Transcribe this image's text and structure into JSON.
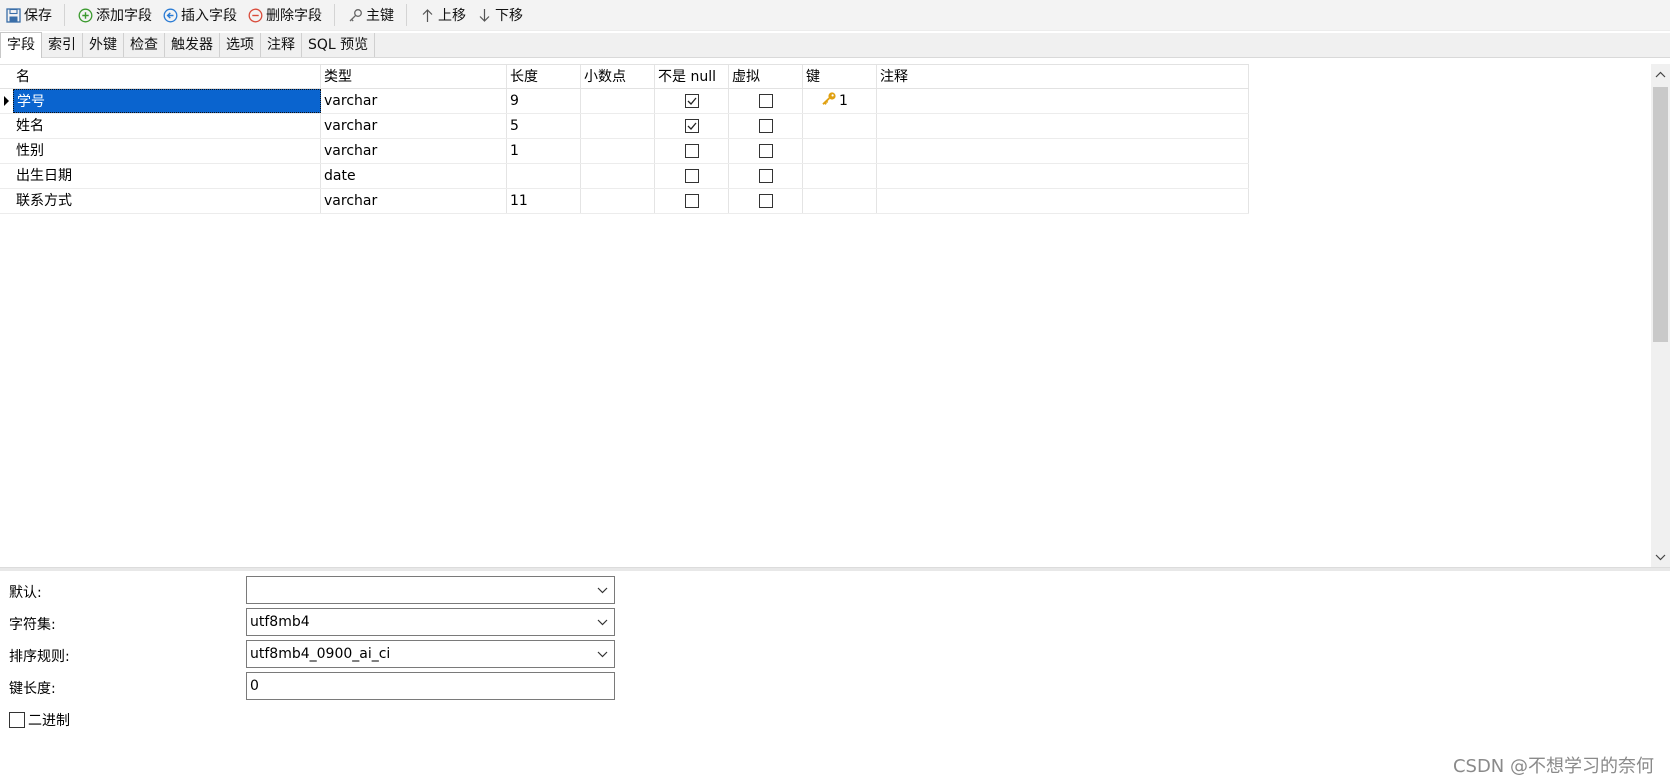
{
  "toolbar": {
    "save": "保存",
    "add_field": "添加字段",
    "insert_field": "插入字段",
    "delete_field": "删除字段",
    "primary_key": "主键",
    "move_up": "上移",
    "move_down": "下移"
  },
  "tabs": [
    {
      "label": "字段",
      "active": true
    },
    {
      "label": "索引"
    },
    {
      "label": "外键"
    },
    {
      "label": "检查"
    },
    {
      "label": "触发器"
    },
    {
      "label": "选项"
    },
    {
      "label": "注释"
    },
    {
      "label": "SQL 预览"
    }
  ],
  "grid": {
    "headers": {
      "name": "名",
      "type": "类型",
      "length": "长度",
      "decimals": "小数点",
      "not_null": "不是 null",
      "virtual": "虚拟",
      "key": "键",
      "comment": "注释"
    },
    "rows": [
      {
        "name": "学号",
        "type": "varchar",
        "length": "9",
        "decimals": "",
        "not_null": true,
        "virtual": false,
        "key": "1",
        "comment": ""
      },
      {
        "name": "姓名",
        "type": "varchar",
        "length": "5",
        "decimals": "",
        "not_null": true,
        "virtual": false,
        "key": "",
        "comment": ""
      },
      {
        "name": "性别",
        "type": "varchar",
        "length": "1",
        "decimals": "",
        "not_null": false,
        "virtual": false,
        "key": "",
        "comment": ""
      },
      {
        "name": "出生日期",
        "type": "date",
        "length": "",
        "decimals": "",
        "not_null": false,
        "virtual": false,
        "key": "",
        "comment": ""
      },
      {
        "name": "联系方式",
        "type": "varchar",
        "length": "11",
        "decimals": "",
        "not_null": false,
        "virtual": false,
        "key": "",
        "comment": ""
      }
    ]
  },
  "properties": {
    "default_label": "默认:",
    "default_value": "",
    "charset_label": "字符集:",
    "charset_value": "utf8mb4",
    "collation_label": "排序规则:",
    "collation_value": "utf8mb4_0900_ai_ci",
    "key_length_label": "键长度:",
    "key_length_value": "0",
    "binary_label": "二进制",
    "binary_checked": false
  },
  "watermark": "CSDN @不想学习的奈何",
  "colors": {
    "selection": "#0a64cf",
    "add_icon": "#3a9a2e",
    "insert_icon": "#2a7bd4",
    "delete_icon": "#d94b3a",
    "key_icon": "#e0a010"
  }
}
